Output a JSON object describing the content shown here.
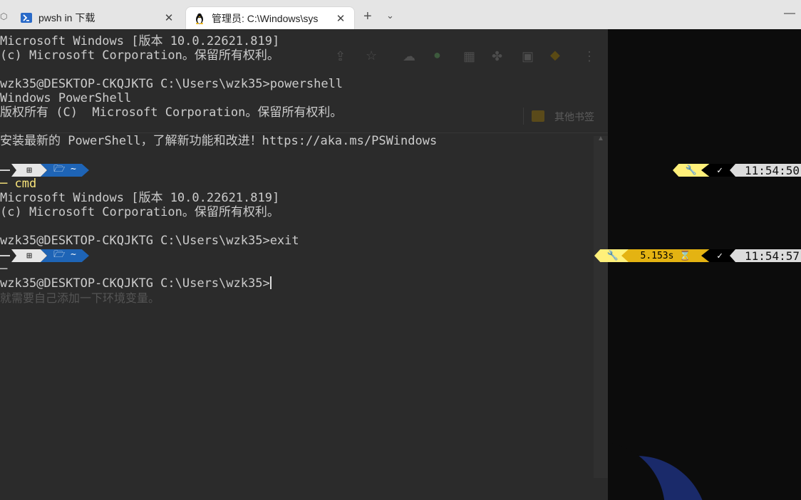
{
  "tabs": [
    {
      "label": "pwsh in 下载",
      "icon": "powershell-icon",
      "close": "✕"
    },
    {
      "label": "管理员: C:\\Windows\\sys",
      "icon": "linux-penguin-icon",
      "close": "✕"
    }
  ],
  "tabbar": {
    "new_tab": "+",
    "dropdown": "⌄",
    "minimize": "—"
  },
  "browser_ghost": {
    "bookmarks_label": "其他书签"
  },
  "terminal": {
    "lines": [
      "Microsoft Windows [版本 10.0.22621.819]",
      "(c) Microsoft Corporation。保留所有权利。",
      "wzk35@DESKTOP-CKQJKTG C:\\Users\\wzk35>powershell",
      "Windows PowerShell",
      "版权所有 (C)  Microsoft Corporation。保留所有权利。",
      "安装最新的 PowerShell，了解新功能和改进！https://aka.ms/PSWindows",
      "─ cmd",
      "Microsoft Windows [版本 10.0.22621.819]",
      "(c) Microsoft Corporation。保留所有权利。",
      "wzk35@DESKTOP-CKQJKTG C:\\Users\\wzk35>exit",
      "─",
      "wzk35@DESKTOP-CKQJKTG C:\\Users\\wzk35>"
    ],
    "ghost_text": "就需要自己添加一下环境变量。",
    "prompt1": {
      "os": "⊞",
      "path": "🗁 ~",
      "tool": "🔧",
      "status": "✓",
      "time": "11:54:50"
    },
    "prompt2": {
      "os": "⊞",
      "path": "🗁 ~",
      "tool": "🔧",
      "exec": "5.153s ⌛",
      "status": "✓",
      "time": "11:54:57"
    }
  },
  "colors": {
    "terminal_bg": "#2b2b2b",
    "path_segment": "#1e64b6",
    "tool_segment": "#fff07a",
    "exec_segment": "#e4b312"
  }
}
